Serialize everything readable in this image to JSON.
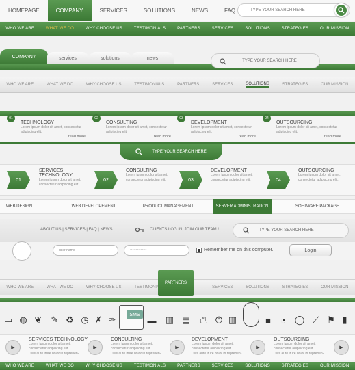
{
  "top_nav": {
    "items": [
      "HOMEPAGE",
      "COMPANY",
      "SERVICES",
      "SOLUTIONS",
      "NEWS",
      "FAQ"
    ],
    "search_placeholder": "TYPE YOUR SEARCH HERE"
  },
  "green_nav_1": {
    "items": [
      "WHO WE ARE",
      "WHAT WE DO",
      "WHY CHOOSE US",
      "TESTIMONIALS",
      "PARTNERS",
      "SERVICES",
      "SOLUTIONS",
      "STRATEGIES",
      "OUR MISSION"
    ]
  },
  "tab_nav": {
    "items": [
      "COMPANY",
      "services",
      "solutions",
      "news"
    ],
    "search_placeholder": "TYPE YOUR SEARCH HERE"
  },
  "grey_nav_1": {
    "items": [
      "WHO WE ARE",
      "WHAT WE DO",
      "WHY CHOOSE US",
      "TESTIMONIALS",
      "PARTNERS",
      "SERVICES",
      "SOLUTIONS",
      "STRATEGIES",
      "OUR MISSION"
    ]
  },
  "cards_1": [
    {
      "num": "01",
      "title": "TECHNOLOGY",
      "text1": "Lorem ipsum dolor sit amet, consectetur",
      "text2": "adipiscing elit.",
      "more": "read more"
    },
    {
      "num": "02",
      "title": "CONSULTING",
      "text1": "Lorem ipsum dolor sit amet, consectetur",
      "text2": "adipiscing elit.",
      "more": "read more"
    },
    {
      "num": "03",
      "title": "DEVELOPMENT",
      "text1": "Lorem ipsum dolor sit amet, consectetur",
      "text2": "adipiscing elit.",
      "more": "read more"
    },
    {
      "num": "04",
      "title": "OUTSOURCING",
      "text1": "Lorem ipsum dolor sit amet, consectetur",
      "text2": "adipiscing elit.",
      "more": "read more"
    }
  ],
  "mid_search": {
    "placeholder": "TYPE YOUR SEARCH HERE"
  },
  "cards_2": [
    {
      "num": "01",
      "title": "SERVICES TECHNOLOGY",
      "text1": "Lorem ipsum dolor sit amet,",
      "text2": "consectetur adipiscing elit."
    },
    {
      "num": "02",
      "title": "CONSULTING",
      "text1": "Lorem ipsum dolor sit amet,",
      "text2": "consectetur adipiscing elit."
    },
    {
      "num": "03",
      "title": "DEVELOPMENT",
      "text1": "Lorem ipsum dolor sit amet,",
      "text2": "consectetur adipiscing elit."
    },
    {
      "num": "04",
      "title": "OUTSOURCING",
      "text1": "Lorem ipsum dolor sit amet,",
      "text2": "consectetur adipiscing elit."
    }
  ],
  "sub_nav": {
    "items": [
      "WEB DESIGN",
      "WEB DEVELOPEMENT",
      "PRODUCT MANAGEMENT",
      "SERVER ADMINISTRATION",
      "SOFTWARE PACKAGE"
    ]
  },
  "login_bar": {
    "links": "ABOUT US | SERVICES | FAQ | NEWS",
    "clients": "CLIENTS LOG IN, JOIN OUR TEAM !",
    "search_placeholder": "TYPE YOUR SEARCH HERE",
    "username": "user name",
    "password": "••••••••••••••",
    "remember": "Remember me on this computer.",
    "login": "Login"
  },
  "grey_nav_2": {
    "items": [
      "WHO WE ARE",
      "WHAT WE DO",
      "WHY CHOOSE US",
      "TESTIMONIALS",
      "PARTNERS",
      "SERVICES",
      "SOLUTIONS",
      "STRATEGIES",
      "OUR MISSION"
    ]
  },
  "icons": [
    "browser-icon",
    "globe-icon",
    "chat-icon",
    "ruler-icon",
    "trash-icon",
    "stopwatch-icon",
    "tools-icon",
    "pen-icon",
    "calculator-icon",
    "sms-icon",
    "monitor-icon",
    "battery-icon",
    "server-icon",
    "printer-icon",
    "power-icon",
    "folders-icon",
    "mouse-icon",
    "camera-icon",
    "clock-icon",
    "speech-icon",
    "feather-icon",
    "flag-icon",
    "bar-chart-icon"
  ],
  "sms_label": "SMS",
  "cards_3": [
    {
      "title": "SERVICES TECHNOLOGY",
      "text1": "Lorem ipsum dolor sit amet,",
      "text2": "consectetur adipiscing elit.",
      "text3": "Duis aute irure dolor in reprehen-"
    },
    {
      "title": "CONSULTING",
      "text1": "Lorem ipsum dolor sit amet,",
      "text2": "consectetur adipiscing elit.",
      "text3": "Duis aute irure dolor in reprehen-"
    },
    {
      "title": "DEVELOPMENT",
      "text1": "Lorem ipsum dolor sit amet,",
      "text2": "consectetur adipiscing elit.",
      "text3": "Duis aute irure dolor in reprehen-"
    },
    {
      "title": "OUTSOURCING",
      "text1": "Lorem ipsum dolor sit amet,",
      "text2": "consectetur adipiscing elit.",
      "text3": "Duis aute irure dolor in reprehen-"
    }
  ],
  "green_nav_2": {
    "items": [
      "WHO WE ARE",
      "WHAT WE DO",
      "WHY CHOOSE US",
      "TESTIMONIALS",
      "PARTNERS",
      "SERVICES",
      "SOLUTIONS",
      "STRATEGIES",
      "OUR MISSION"
    ]
  },
  "colors": {
    "green": "#3d7a36",
    "accent": "#e8c34a"
  }
}
